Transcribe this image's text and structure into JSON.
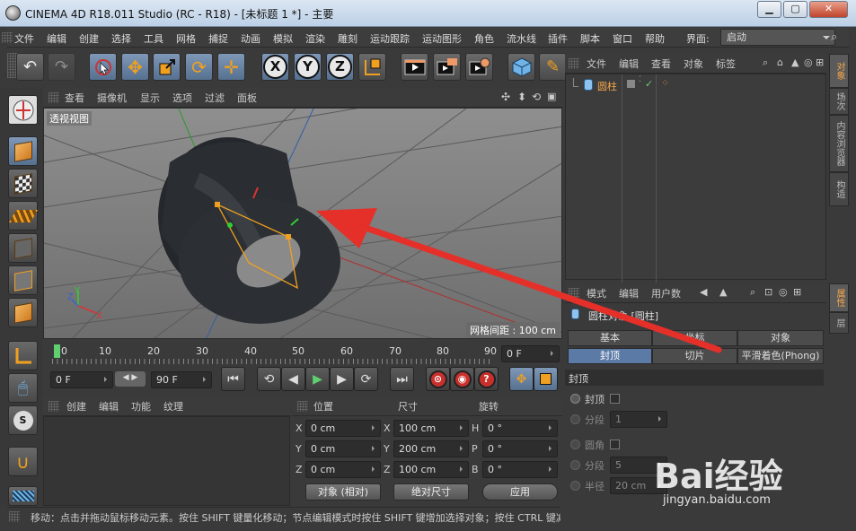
{
  "window": {
    "title": "CINEMA 4D R18.011 Studio (RC - R18) - [未标题 1 *] - 主要",
    "minimize": "▁",
    "maximize": "▢",
    "close": "✕"
  },
  "menubar": {
    "items": [
      "文件",
      "编辑",
      "创建",
      "选择",
      "工具",
      "网格",
      "捕捉",
      "动画",
      "模拟",
      "渲染",
      "雕刻",
      "运动跟踪",
      "运动图形",
      "角色",
      "流水线",
      "插件",
      "脚本",
      "窗口",
      "帮助"
    ],
    "layout_label": "界面:",
    "layout_value": "启动"
  },
  "toolbar": {
    "icons": [
      "undo-icon",
      "redo-icon",
      "live-selection-icon",
      "move-icon",
      "scale-icon",
      "rotate-icon",
      "move-plus-icon",
      "x-axis-icon",
      "y-axis-icon",
      "z-axis-icon",
      "world-coords-icon",
      "render-view-icon",
      "render-picture-queue-icon",
      "render-settings-icon",
      "cube-icon",
      "pen-icon"
    ],
    "x_label": "X",
    "y_label": "Y",
    "z_label": "Z"
  },
  "viewport": {
    "menu": [
      "查看",
      "摄像机",
      "显示",
      "选项",
      "过滤",
      "面板"
    ],
    "camera_label": "透视视图",
    "grid_spacing": "网格间距 : 100 cm",
    "axis_x": "X",
    "axis_y": "Y",
    "axis_z": "Z"
  },
  "timeline": {
    "ticks": [
      "0",
      "10",
      "20",
      "30",
      "40",
      "50",
      "60",
      "70",
      "80",
      "90"
    ],
    "current_frame": "0 F",
    "start_field": "0 F",
    "end_field": "90 F"
  },
  "object_manager": {
    "menu": [
      "文件",
      "编辑",
      "查看",
      "对象",
      "标签"
    ],
    "object_name": "圆柱"
  },
  "side_tabs": {
    "top": [
      "对象",
      "场次",
      "内容浏览器",
      "构造"
    ],
    "bottom": [
      "属性",
      "层"
    ]
  },
  "attributes": {
    "menu": [
      "模式",
      "编辑",
      "用户数"
    ],
    "object_title": "圆柱对象 [圆柱]",
    "tabs_row1": [
      "基本",
      "坐标",
      "对象"
    ],
    "tabs_row2": [
      "封顶",
      "切片",
      "平滑着色(Phong)"
    ],
    "section": "封顶",
    "caps_label": "封顶",
    "cap_segments_label": "分段",
    "cap_segments_value": "1",
    "fillet_label": "圆角",
    "fillet_segments_label": "分段",
    "fillet_segments_value": "5",
    "radius_label": "半径",
    "radius_value": "20 cm"
  },
  "material_manager": {
    "menu": [
      "创建",
      "编辑",
      "功能",
      "纹理"
    ]
  },
  "coordinates": {
    "headers": [
      "位置",
      "尺寸",
      "旋转"
    ],
    "pos_labels": [
      "X",
      "Y",
      "Z"
    ],
    "pos_values": [
      "0 cm",
      "0 cm",
      "0 cm"
    ],
    "size_labels": [
      "X",
      "Y",
      "Z"
    ],
    "size_values": [
      "100 cm",
      "200 cm",
      "100 cm"
    ],
    "rot_labels": [
      "H",
      "P",
      "B"
    ],
    "rot_values": [
      "0 °",
      "0 °",
      "0 °"
    ],
    "mode_object": "对象 (相对)",
    "mode_size": "绝对尺寸",
    "apply": "应用"
  },
  "statusbar": {
    "text": "移动：点击并拖动鼠标移动元素。按住 SHIFT 键量化移动；节点编辑模式时按住 SHIFT 键增加选择对象；按住 CTRL 键减"
  },
  "watermark": {
    "brand": "Bai经验",
    "url": "jingyan.baidu.com"
  },
  "colors": {
    "accent_blue": "#5b7aa6",
    "orange_highlight": "#f6a64a",
    "red_arrow": "#e5302a"
  }
}
